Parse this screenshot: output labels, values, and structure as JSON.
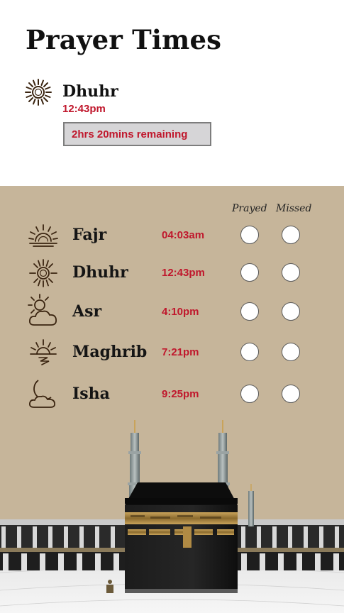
{
  "header": {
    "title": "Prayer Times"
  },
  "current": {
    "name": "Dhuhr",
    "time": "12:43pm",
    "icon": "sun-icon",
    "remaining": "2hrs 20mins remaining"
  },
  "table": {
    "col_prayed": "Prayed",
    "col_missed": "Missed",
    "rows": [
      {
        "name": "Fajr",
        "time": "04:03am",
        "icon": "sunrise-icon"
      },
      {
        "name": "Dhuhr",
        "time": "12:43pm",
        "icon": "sun-icon"
      },
      {
        "name": "Asr",
        "time": "4:10pm",
        "icon": "sun-cloud-icon"
      },
      {
        "name": "Maghrib",
        "time": "7:21pm",
        "icon": "sunset-icon"
      },
      {
        "name": "Isha",
        "time": "9:25pm",
        "icon": "moon-cloud-icon"
      }
    ]
  },
  "colors": {
    "accent": "#c0172c",
    "panel": "#c6b59a",
    "icon": "#3a2410"
  }
}
